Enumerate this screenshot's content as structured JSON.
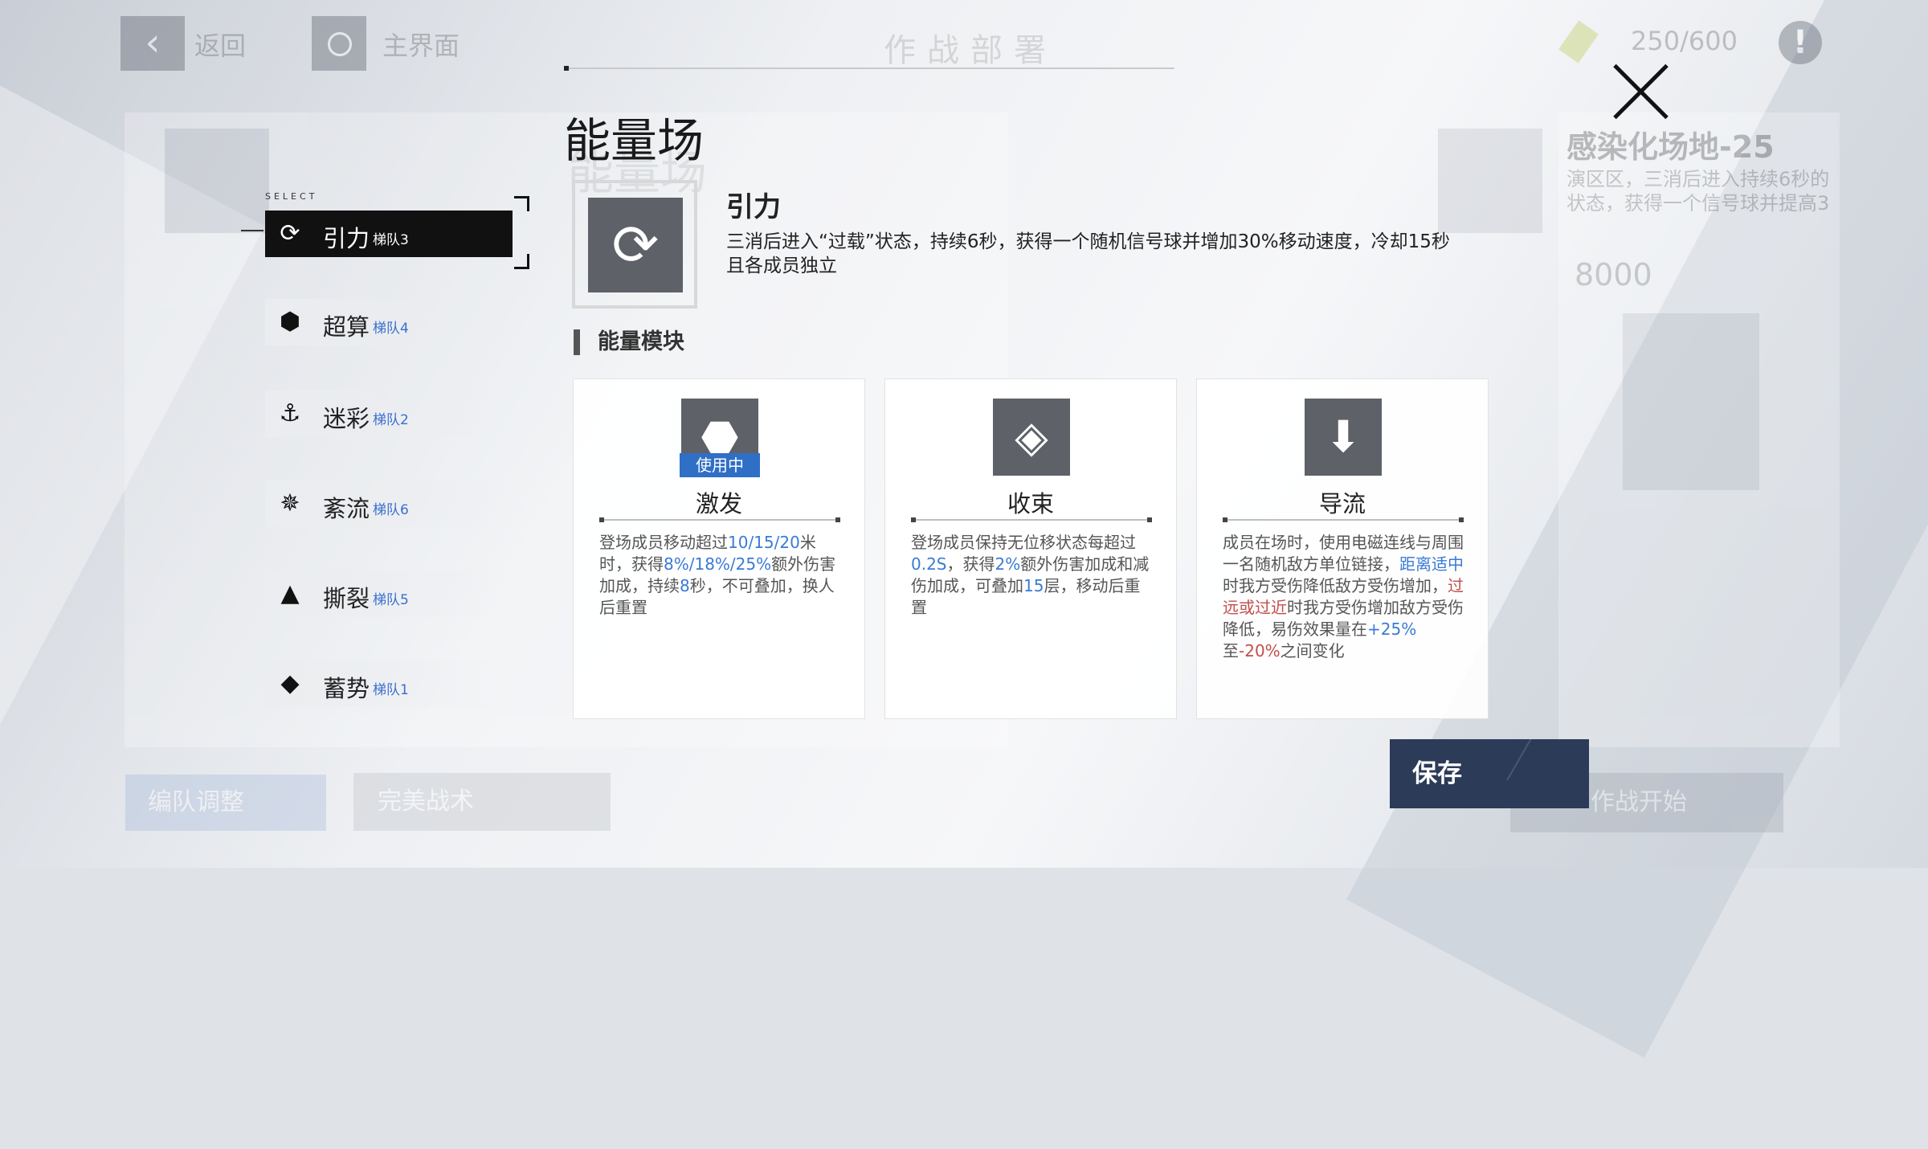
{
  "underlay": {
    "back_label": "返回",
    "home_label": "主界面",
    "screen_title": "作战部署",
    "energy": "250/600",
    "stage_name": "感染化场地-25",
    "stage_desc": "演区区，三消后进入持续6秒的状态，获得一个信号球并提高3",
    "score": "8000",
    "btn_formation": "编队调整",
    "btn_perfect": "完美战术",
    "btn_start": "作战开始"
  },
  "modal": {
    "title": "能量场",
    "select_tag": "SELECT",
    "fields": [
      {
        "name": "引力",
        "team": "梯队3",
        "icon": "gravity-icon",
        "active": true
      },
      {
        "name": "超算",
        "team": "梯队4",
        "icon": "supercompute-icon",
        "active": false
      },
      {
        "name": "迷彩",
        "team": "梯队2",
        "icon": "camo-icon",
        "active": false
      },
      {
        "name": "紊流",
        "team": "梯队6",
        "icon": "turbulence-icon",
        "active": false
      },
      {
        "name": "撕裂",
        "team": "梯队5",
        "icon": "tear-icon",
        "active": false
      },
      {
        "name": "蓄势",
        "team": "梯队1",
        "icon": "charge-icon",
        "active": false
      }
    ],
    "selected": {
      "name": "引力",
      "desc_line1": "三消后进入“过载”状态，持续6秒，获得一个随机信号球并增加30%移动速度，冷却15秒",
      "desc_line2": "且各成员独立"
    },
    "section_label": "能量模块",
    "modules": [
      {
        "name": "激发",
        "in_use": "使用中",
        "desc": {
          "p1": "登场成员移动超过",
          "h1": "10/15/20",
          "p2": "米时，获得",
          "h2": "8%/18%/25%",
          "p3": "额外伤害加成，持续",
          "h3": "8",
          "p4": "秒，不可叠加，换人后重置"
        }
      },
      {
        "name": "收束",
        "desc": {
          "p1": "登场成员保持无位移状态每超过",
          "h1": "0.2S",
          "p2": "，获得",
          "h2": "2%",
          "p3": "额外伤害加成和减伤加成，可叠加",
          "h3": "15",
          "p4": "层，移动后重置"
        }
      },
      {
        "name": "导流",
        "desc": {
          "p1": "成员在场时，使用电磁连线与周围一名随机敌方单位链接，",
          "h1": "距离适中",
          "p2": "时我方受伤降低敌方受伤增加，",
          "r1": "过远或过近",
          "p3": "时我方受伤增加敌方受伤降低，易伤效果量在",
          "h2": "+25%",
          "p4": "至",
          "r2": "-20%",
          "p5": "之间变化"
        }
      }
    ],
    "save_label": "保存"
  },
  "colors": {
    "accent_blue": "#3a7bd5",
    "accent_red": "#c0504d",
    "save_bg": "#2b3b58",
    "in_use_bg": "#2f6fc5"
  }
}
